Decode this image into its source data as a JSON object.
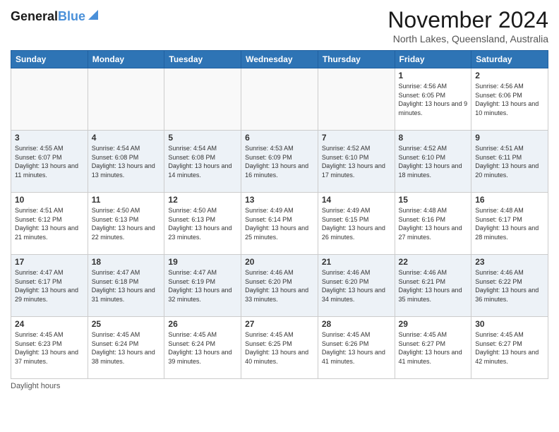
{
  "header": {
    "logo_line1": "General",
    "logo_line2": "Blue",
    "title": "November 2024",
    "location": "North Lakes, Queensland, Australia"
  },
  "footer": {
    "daylight_label": "Daylight hours"
  },
  "days_of_week": [
    "Sunday",
    "Monday",
    "Tuesday",
    "Wednesday",
    "Thursday",
    "Friday",
    "Saturday"
  ],
  "weeks": [
    [
      {
        "day": "",
        "info": ""
      },
      {
        "day": "",
        "info": ""
      },
      {
        "day": "",
        "info": ""
      },
      {
        "day": "",
        "info": ""
      },
      {
        "day": "",
        "info": ""
      },
      {
        "day": "1",
        "info": "Sunrise: 4:56 AM\nSunset: 6:05 PM\nDaylight: 13 hours and 9 minutes."
      },
      {
        "day": "2",
        "info": "Sunrise: 4:56 AM\nSunset: 6:06 PM\nDaylight: 13 hours and 10 minutes."
      }
    ],
    [
      {
        "day": "3",
        "info": "Sunrise: 4:55 AM\nSunset: 6:07 PM\nDaylight: 13 hours and 11 minutes."
      },
      {
        "day": "4",
        "info": "Sunrise: 4:54 AM\nSunset: 6:08 PM\nDaylight: 13 hours and 13 minutes."
      },
      {
        "day": "5",
        "info": "Sunrise: 4:54 AM\nSunset: 6:08 PM\nDaylight: 13 hours and 14 minutes."
      },
      {
        "day": "6",
        "info": "Sunrise: 4:53 AM\nSunset: 6:09 PM\nDaylight: 13 hours and 16 minutes."
      },
      {
        "day": "7",
        "info": "Sunrise: 4:52 AM\nSunset: 6:10 PM\nDaylight: 13 hours and 17 minutes."
      },
      {
        "day": "8",
        "info": "Sunrise: 4:52 AM\nSunset: 6:10 PM\nDaylight: 13 hours and 18 minutes."
      },
      {
        "day": "9",
        "info": "Sunrise: 4:51 AM\nSunset: 6:11 PM\nDaylight: 13 hours and 20 minutes."
      }
    ],
    [
      {
        "day": "10",
        "info": "Sunrise: 4:51 AM\nSunset: 6:12 PM\nDaylight: 13 hours and 21 minutes."
      },
      {
        "day": "11",
        "info": "Sunrise: 4:50 AM\nSunset: 6:13 PM\nDaylight: 13 hours and 22 minutes."
      },
      {
        "day": "12",
        "info": "Sunrise: 4:50 AM\nSunset: 6:13 PM\nDaylight: 13 hours and 23 minutes."
      },
      {
        "day": "13",
        "info": "Sunrise: 4:49 AM\nSunset: 6:14 PM\nDaylight: 13 hours and 25 minutes."
      },
      {
        "day": "14",
        "info": "Sunrise: 4:49 AM\nSunset: 6:15 PM\nDaylight: 13 hours and 26 minutes."
      },
      {
        "day": "15",
        "info": "Sunrise: 4:48 AM\nSunset: 6:16 PM\nDaylight: 13 hours and 27 minutes."
      },
      {
        "day": "16",
        "info": "Sunrise: 4:48 AM\nSunset: 6:17 PM\nDaylight: 13 hours and 28 minutes."
      }
    ],
    [
      {
        "day": "17",
        "info": "Sunrise: 4:47 AM\nSunset: 6:17 PM\nDaylight: 13 hours and 29 minutes."
      },
      {
        "day": "18",
        "info": "Sunrise: 4:47 AM\nSunset: 6:18 PM\nDaylight: 13 hours and 31 minutes."
      },
      {
        "day": "19",
        "info": "Sunrise: 4:47 AM\nSunset: 6:19 PM\nDaylight: 13 hours and 32 minutes."
      },
      {
        "day": "20",
        "info": "Sunrise: 4:46 AM\nSunset: 6:20 PM\nDaylight: 13 hours and 33 minutes."
      },
      {
        "day": "21",
        "info": "Sunrise: 4:46 AM\nSunset: 6:20 PM\nDaylight: 13 hours and 34 minutes."
      },
      {
        "day": "22",
        "info": "Sunrise: 4:46 AM\nSunset: 6:21 PM\nDaylight: 13 hours and 35 minutes."
      },
      {
        "day": "23",
        "info": "Sunrise: 4:46 AM\nSunset: 6:22 PM\nDaylight: 13 hours and 36 minutes."
      }
    ],
    [
      {
        "day": "24",
        "info": "Sunrise: 4:45 AM\nSunset: 6:23 PM\nDaylight: 13 hours and 37 minutes."
      },
      {
        "day": "25",
        "info": "Sunrise: 4:45 AM\nSunset: 6:24 PM\nDaylight: 13 hours and 38 minutes."
      },
      {
        "day": "26",
        "info": "Sunrise: 4:45 AM\nSunset: 6:24 PM\nDaylight: 13 hours and 39 minutes."
      },
      {
        "day": "27",
        "info": "Sunrise: 4:45 AM\nSunset: 6:25 PM\nDaylight: 13 hours and 40 minutes."
      },
      {
        "day": "28",
        "info": "Sunrise: 4:45 AM\nSunset: 6:26 PM\nDaylight: 13 hours and 41 minutes."
      },
      {
        "day": "29",
        "info": "Sunrise: 4:45 AM\nSunset: 6:27 PM\nDaylight: 13 hours and 41 minutes."
      },
      {
        "day": "30",
        "info": "Sunrise: 4:45 AM\nSunset: 6:27 PM\nDaylight: 13 hours and 42 minutes."
      }
    ]
  ]
}
